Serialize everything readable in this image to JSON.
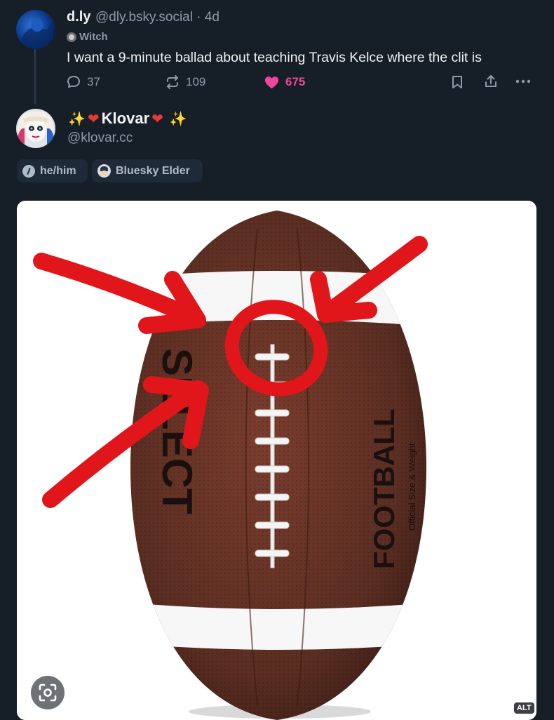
{
  "parent_post": {
    "display_name": "d.ly",
    "handle": "@dly.bsky.social · 4d",
    "profile_badge": "Witch",
    "text": "I want a 9-minute ballad about teaching Travis Kelce where the clit is",
    "actions": {
      "replies": "37",
      "reposts": "109",
      "likes": "675"
    },
    "like_color": "#ec4899"
  },
  "author": {
    "display_name": "Klovar",
    "handle": "@klovar.cc",
    "name_decorations": [
      "✨",
      "❤",
      "❤",
      "✨"
    ],
    "pills": [
      {
        "label": "he/him",
        "icon": "pronoun-icon"
      },
      {
        "label": "Bluesky Elder",
        "icon": "elder-badge-icon"
      }
    ]
  },
  "media": {
    "description_icon": "football-image",
    "ball_text_left": "SELECT",
    "ball_text_right": "FOOTBALL",
    "ball_subtext": "Official Size & Weight",
    "alt_label": "ALT",
    "lens_icon": "lens-icon"
  },
  "colors": {
    "background": "#161e27",
    "text_muted": "#8d9aa9",
    "annotation_red": "#e0161b",
    "ball_brown": "#5b2e22"
  }
}
